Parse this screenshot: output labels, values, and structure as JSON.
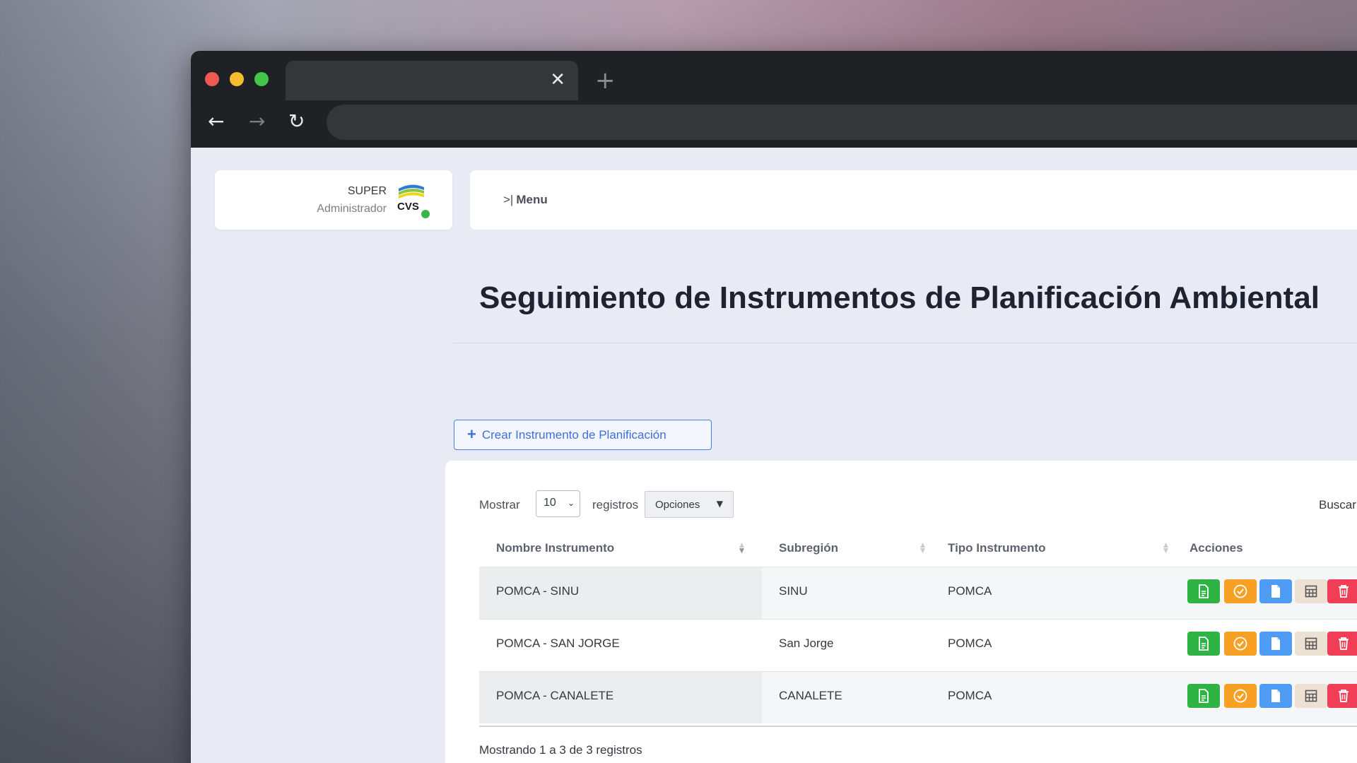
{
  "browser": {
    "tab_close": "✕",
    "new_tab": "+",
    "back": "←",
    "forward": "→",
    "reload": "↻"
  },
  "user": {
    "role": "SUPER",
    "subtitle": "Administrador",
    "logo_text": "CVS",
    "status": "online"
  },
  "menu": {
    "toggle_icon": ">|",
    "label": "Menu"
  },
  "page": {
    "title": "Seguimiento de Instrumentos de Planificación Ambiental"
  },
  "create_button": {
    "icon": "+",
    "label": "Crear Instrumento de Planificación"
  },
  "table_controls": {
    "show_label": "Mostrar",
    "page_length": "10",
    "records_label": "registros",
    "options_label": "Opciones",
    "search_label": "Buscar:"
  },
  "table": {
    "columns": [
      "Nombre Instrumento",
      "Subregión",
      "Tipo Instrumento",
      "Acciones"
    ],
    "rows": [
      {
        "nombre": "POMCA - SINU",
        "subregion": "SINU",
        "tipo": "POMCA"
      },
      {
        "nombre": "POMCA - SAN JORGE",
        "subregion": "San Jorge",
        "tipo": "POMCA"
      },
      {
        "nombre": "POMCA - CANALETE",
        "subregion": "CANALETE",
        "tipo": "POMCA"
      }
    ],
    "actions": [
      "document-icon",
      "check-circle-icon",
      "file-icon",
      "calculator-icon",
      "trash-icon"
    ],
    "info": "Mostrando 1 a 3 de 3 registros"
  },
  "colors": {
    "accent": "#3f6fd9",
    "action_green": "#2fb344",
    "action_orange": "#f7a024",
    "action_blue": "#4f9cf5",
    "action_beige": "#ede1d3",
    "action_red": "#ef3e56",
    "status_online": "#3bb54a"
  }
}
